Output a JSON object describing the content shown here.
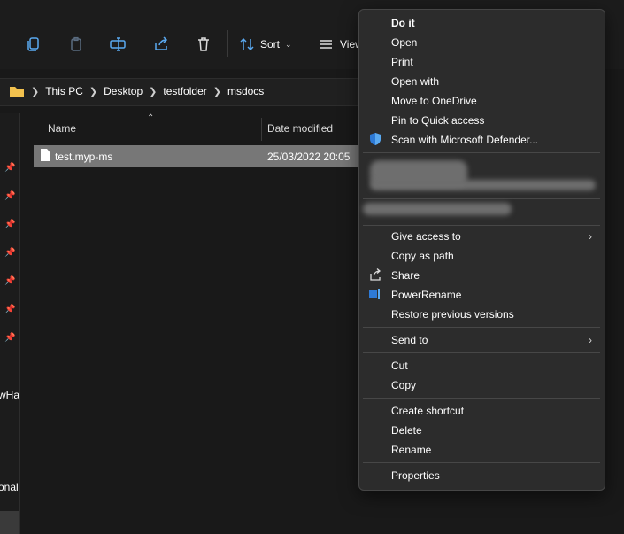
{
  "toolbar": {
    "sort_label": "Sort",
    "view_label": "View",
    "icons": [
      "copy-icon",
      "paste-icon",
      "rename-icon",
      "share-icon",
      "delete-icon",
      "sort-icon",
      "view-icon"
    ]
  },
  "address_bar": {
    "crumbs": [
      "This PC",
      "Desktop",
      "testfolder",
      "msdocs"
    ]
  },
  "nav_pane": {
    "partial_labels": [
      "wHa",
      "onal"
    ]
  },
  "columns": {
    "name": "Name",
    "date_modified": "Date modified"
  },
  "files": [
    {
      "name": "test.myp-ms",
      "date_modified": "25/03/2022 20:05",
      "selected": true
    }
  ],
  "context_menu": {
    "group1": [
      "Do it",
      "Open",
      "Print",
      "Open with",
      "Move to OneDrive",
      "Pin to Quick access",
      "Scan with Microsoft Defender..."
    ],
    "group2": [
      "Give access to",
      "Copy as path",
      "Share",
      "PowerRename",
      "Restore previous versions"
    ],
    "group3": [
      "Send to"
    ],
    "group4": [
      "Cut",
      "Copy"
    ],
    "group5": [
      "Create shortcut",
      "Delete",
      "Rename"
    ],
    "group6": [
      "Properties"
    ]
  },
  "colors": {
    "background": "#191919",
    "menu_bg": "#2c2c2c",
    "selection": "#777777",
    "defender_blue": "#2e7ad6",
    "folder_yellow": "#f2c14e"
  }
}
